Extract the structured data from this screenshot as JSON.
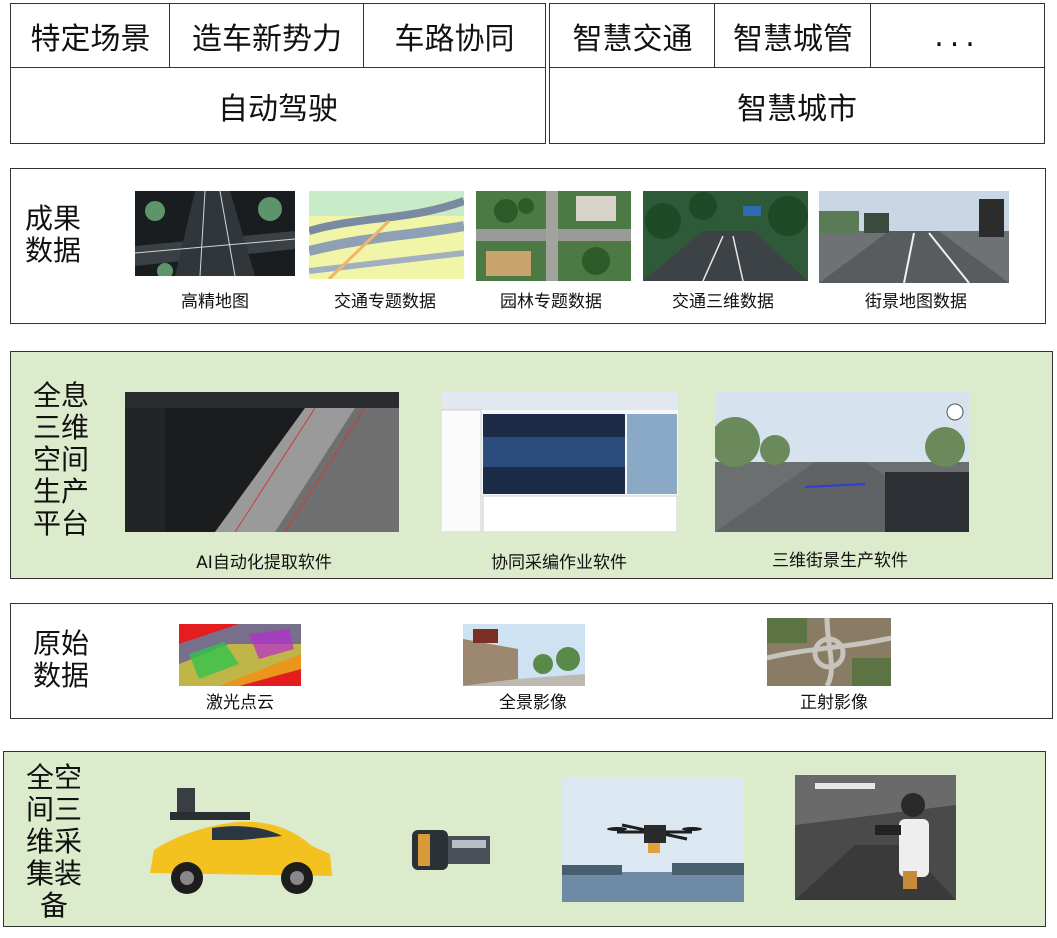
{
  "scenarios": {
    "left_items": [
      "特定场景",
      "造车新势力",
      "车路协同"
    ],
    "left_group": "自动驾驶",
    "right_items": [
      "智慧交通",
      "智慧城管",
      "..."
    ],
    "right_group": "智慧城市"
  },
  "result_data": {
    "side_label": [
      "成果",
      "数据"
    ],
    "items": [
      {
        "caption": "高精地图",
        "icon": "hd-map-image"
      },
      {
        "caption": "交通专题数据",
        "icon": "traffic-thematic-image"
      },
      {
        "caption": "园林专题数据",
        "icon": "garden-thematic-image"
      },
      {
        "caption": "交通三维数据",
        "icon": "traffic-3d-image"
      },
      {
        "caption": "街景地图数据",
        "icon": "street-view-image"
      }
    ]
  },
  "platform": {
    "side_label": [
      "全息",
      "三维",
      "空间",
      "生产",
      "平台"
    ],
    "items": [
      {
        "caption": "AI自动化提取软件",
        "icon": "ai-extraction-software-image"
      },
      {
        "caption": "协同采编作业软件",
        "icon": "collaborative-editing-software-image"
      },
      {
        "caption": "三维街景生产软件",
        "icon": "3d-streetview-software-image"
      }
    ]
  },
  "raw_data": {
    "side_label": [
      "原始",
      "数据"
    ],
    "items": [
      {
        "caption": "激光点云",
        "icon": "laser-point-cloud-image"
      },
      {
        "caption": "全景影像",
        "icon": "panoramic-image"
      },
      {
        "caption": "正射影像",
        "icon": "orthophoto-image"
      }
    ]
  },
  "equipment": {
    "side_label": [
      "全空",
      "间三",
      "维采",
      "集装",
      "备"
    ],
    "items": [
      {
        "icon": "vehicle-mapping-car-image"
      },
      {
        "icon": "lidar-scanner-image"
      },
      {
        "icon": "drone-image"
      },
      {
        "icon": "handheld-scanner-image"
      }
    ]
  },
  "colors": {
    "section_green": "#dcebcb",
    "border": "#333333"
  }
}
